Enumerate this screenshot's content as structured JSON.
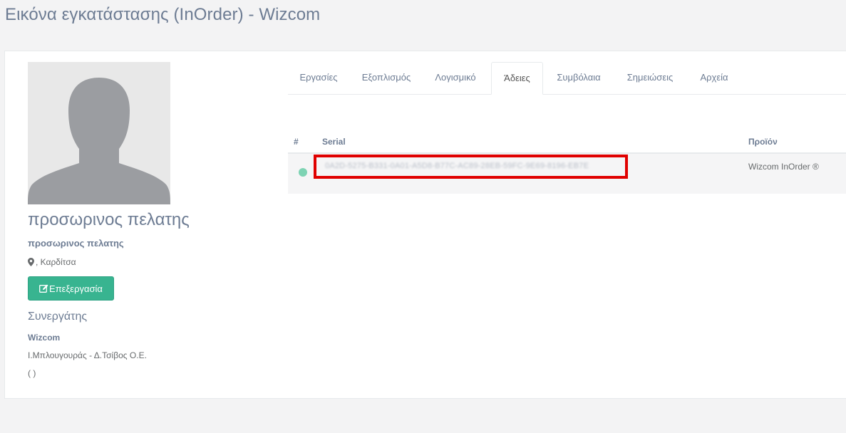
{
  "page": {
    "title": "Εικόνα εγκατάστασης (InOrder) - Wizcom"
  },
  "client": {
    "name": "προσωρινος πελατης",
    "subtitle": "προσωρινος πελατης",
    "location": ", Καρδίτσα",
    "edit_label": "Επεξεργασία"
  },
  "partner": {
    "heading": "Συνεργάτης",
    "name": "Wizcom",
    "company": "Ι.Μπλουγουράς - Δ.Τσίβος Ο.Ε.",
    "phone": "( )"
  },
  "tabs": [
    {
      "label": "Εργασίες",
      "active": false
    },
    {
      "label": "Εξοπλισμός",
      "active": false
    },
    {
      "label": "Λογισμικό",
      "active": false
    },
    {
      "label": "Άδειες",
      "active": true
    },
    {
      "label": "Συμβόλαια",
      "active": false
    },
    {
      "label": "Σημειώσεις",
      "active": false
    },
    {
      "label": "Αρχεία",
      "active": false
    }
  ],
  "licenses": {
    "columns": {
      "index": "#",
      "serial": "Serial",
      "product": "Προϊόν"
    },
    "rows": [
      {
        "status_color": "#7dd3b3",
        "serial": "0A2D-5275-B331-0A01-A5D8-B77C-AC89-28EB-59FC-9E69-8196-EB7E",
        "product": "Wizcom InOrder ®"
      }
    ]
  },
  "colors": {
    "accent_button": "#38b490",
    "highlight_border": "#e00000",
    "status_active": "#7dd3b3"
  }
}
